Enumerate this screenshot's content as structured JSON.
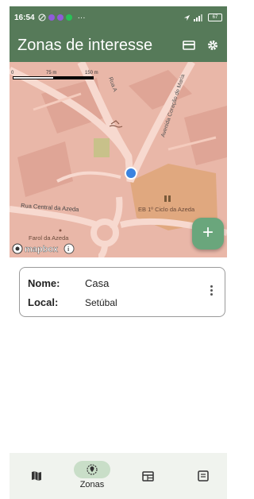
{
  "status_bar": {
    "time": "16:54",
    "battery": "67",
    "more": "···"
  },
  "app_bar": {
    "title": "Zonas de interesse",
    "card_icon": "card-view-icon",
    "settings_icon": "settings-gear-icon"
  },
  "map": {
    "scale_labels": [
      "0",
      "75 m",
      "150 m"
    ],
    "streets": {
      "rua_a": "Rua A",
      "avenida": "Avenida Coração de Maria",
      "rua_central": "Rua Central da Azeda"
    },
    "places": {
      "school": "EB 1º Ciclo da Azeda",
      "farol": "Farol da Azeda"
    },
    "attribution": "mapbox",
    "colors": {
      "base": "#e9b7a8",
      "road": "#f7d9cf",
      "block": "#dfa596",
      "school_area": "#e0a87f",
      "location_dot": "#3b83e0"
    }
  },
  "fab": {
    "label": "+"
  },
  "zone_card": {
    "name_label": "Nome:",
    "name_value": "Casa",
    "local_label": "Local:",
    "local_value": "Setúbal"
  },
  "bottom_nav": {
    "items": [
      {
        "icon": "map-icon",
        "label": ""
      },
      {
        "icon": "zones-icon",
        "label": "Zonas",
        "active": true
      },
      {
        "icon": "table-icon",
        "label": ""
      },
      {
        "icon": "note-icon",
        "label": ""
      }
    ]
  },
  "theme": {
    "primary": "#567a59",
    "fab": "#6aa67c",
    "nav_bg": "#f0f3ee",
    "nav_active": "#c9dec8"
  }
}
